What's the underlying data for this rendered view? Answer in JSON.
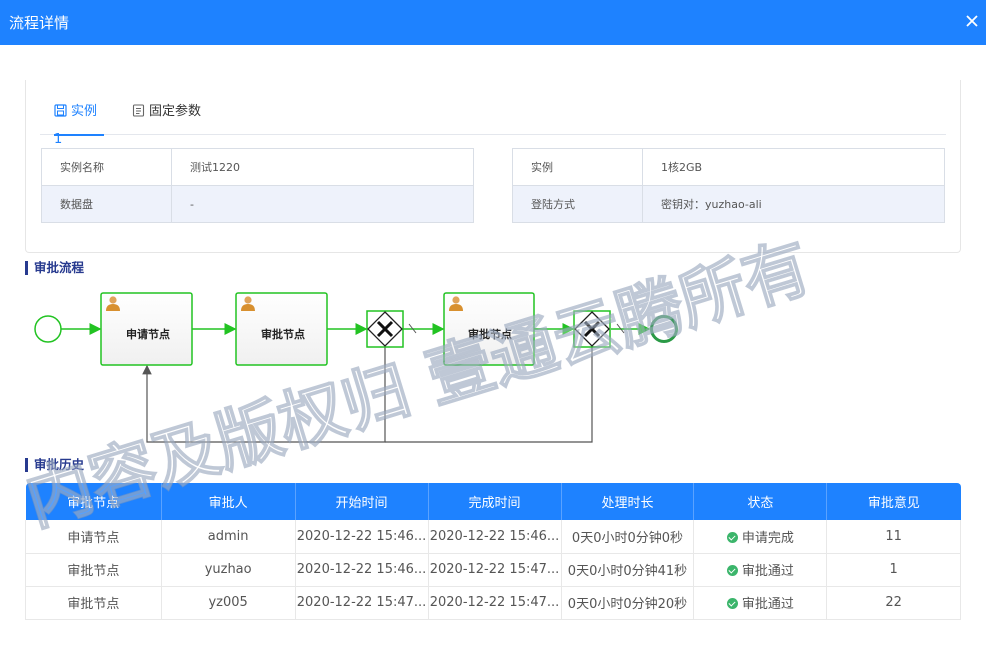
{
  "dialog": {
    "title": "流程详情"
  },
  "tabs": [
    {
      "label": "实例1",
      "icon": "save-icon",
      "active": true
    },
    {
      "label": "固定参数",
      "icon": "document-icon",
      "active": false
    }
  ],
  "instance_info": {
    "left": [
      {
        "key": "实例名称",
        "value": "测试1220"
      },
      {
        "key": "数据盘",
        "value": "-"
      }
    ],
    "right": [
      {
        "key": "实例",
        "value": "1核2GB"
      },
      {
        "key": "登陆方式",
        "value": "密钥对：yuzhao-ali"
      }
    ]
  },
  "approval_flow": {
    "title": "审批流程",
    "nodes": [
      {
        "label": "申请节点",
        "icon": "user-icon"
      },
      {
        "label": "审批节点",
        "icon": "user-icon"
      },
      {
        "label": "审批节点",
        "icon": "user-icon"
      }
    ]
  },
  "history": {
    "title": "审批历史",
    "columns": [
      "审批节点",
      "审批人",
      "开始时间",
      "完成时间",
      "处理时长",
      "状态",
      "审批意见"
    ],
    "rows": [
      {
        "node": "申请节点",
        "approver": "admin",
        "start": "2020-12-22 15:46...",
        "end": "2020-12-22 15:46...",
        "duration": "0天0小时0分钟0秒",
        "status": "申请完成",
        "comment": "11"
      },
      {
        "node": "审批节点",
        "approver": "yuzhao",
        "start": "2020-12-22 15:46...",
        "end": "2020-12-22 15:47...",
        "duration": "0天0小时0分钟41秒",
        "status": "审批通过",
        "comment": "1"
      },
      {
        "node": "审批节点",
        "approver": "yz005",
        "start": "2020-12-22 15:47...",
        "end": "2020-12-22 15:47...",
        "duration": "0天0小时0分钟20秒",
        "status": "审批通过",
        "comment": "22"
      }
    ]
  },
  "watermark": "内容及版权归  壹通云腾所有",
  "colors": {
    "primary": "#1e82ff",
    "flow_green": "#22c322",
    "section_navy": "#273a8f",
    "success": "#3bb56b"
  }
}
